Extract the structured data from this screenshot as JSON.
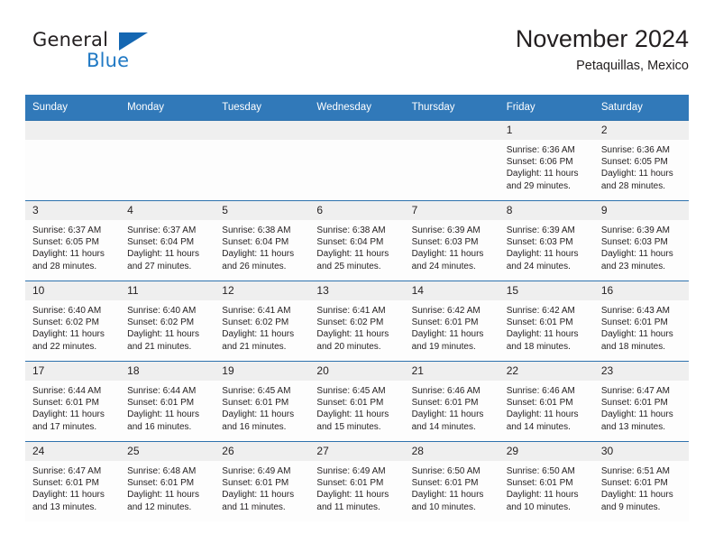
{
  "logo": {
    "word1": "General",
    "word2": "Blue",
    "triangle_color": "#1567b2",
    "blue_color": "#2079c4"
  },
  "header": {
    "title": "November 2024",
    "subtitle": "Petaquillas, Mexico"
  },
  "theme": {
    "header_blue": "#3179b9",
    "row_border_blue": "#2e72ad",
    "daynum_bg": "#efefef",
    "cell_bg": "#fdfdfd",
    "text": "#231f20"
  },
  "labels": {
    "sunrise_prefix": "Sunrise:",
    "sunset_prefix": "Sunset:",
    "daylight_prefix": "Daylight:"
  },
  "weekdays": [
    "Sunday",
    "Monday",
    "Tuesday",
    "Wednesday",
    "Thursday",
    "Friday",
    "Saturday"
  ],
  "weeks": [
    [
      {
        "day": ""
      },
      {
        "day": ""
      },
      {
        "day": ""
      },
      {
        "day": ""
      },
      {
        "day": ""
      },
      {
        "day": "1",
        "sunrise": "Sunrise: 6:36 AM",
        "sunset": "Sunset: 6:06 PM",
        "daylight": "Daylight: 11 hours and 29 minutes."
      },
      {
        "day": "2",
        "sunrise": "Sunrise: 6:36 AM",
        "sunset": "Sunset: 6:05 PM",
        "daylight": "Daylight: 11 hours and 28 minutes."
      }
    ],
    [
      {
        "day": "3",
        "sunrise": "Sunrise: 6:37 AM",
        "sunset": "Sunset: 6:05 PM",
        "daylight": "Daylight: 11 hours and 28 minutes."
      },
      {
        "day": "4",
        "sunrise": "Sunrise: 6:37 AM",
        "sunset": "Sunset: 6:04 PM",
        "daylight": "Daylight: 11 hours and 27 minutes."
      },
      {
        "day": "5",
        "sunrise": "Sunrise: 6:38 AM",
        "sunset": "Sunset: 6:04 PM",
        "daylight": "Daylight: 11 hours and 26 minutes."
      },
      {
        "day": "6",
        "sunrise": "Sunrise: 6:38 AM",
        "sunset": "Sunset: 6:04 PM",
        "daylight": "Daylight: 11 hours and 25 minutes."
      },
      {
        "day": "7",
        "sunrise": "Sunrise: 6:39 AM",
        "sunset": "Sunset: 6:03 PM",
        "daylight": "Daylight: 11 hours and 24 minutes."
      },
      {
        "day": "8",
        "sunrise": "Sunrise: 6:39 AM",
        "sunset": "Sunset: 6:03 PM",
        "daylight": "Daylight: 11 hours and 24 minutes."
      },
      {
        "day": "9",
        "sunrise": "Sunrise: 6:39 AM",
        "sunset": "Sunset: 6:03 PM",
        "daylight": "Daylight: 11 hours and 23 minutes."
      }
    ],
    [
      {
        "day": "10",
        "sunrise": "Sunrise: 6:40 AM",
        "sunset": "Sunset: 6:02 PM",
        "daylight": "Daylight: 11 hours and 22 minutes."
      },
      {
        "day": "11",
        "sunrise": "Sunrise: 6:40 AM",
        "sunset": "Sunset: 6:02 PM",
        "daylight": "Daylight: 11 hours and 21 minutes."
      },
      {
        "day": "12",
        "sunrise": "Sunrise: 6:41 AM",
        "sunset": "Sunset: 6:02 PM",
        "daylight": "Daylight: 11 hours and 21 minutes."
      },
      {
        "day": "13",
        "sunrise": "Sunrise: 6:41 AM",
        "sunset": "Sunset: 6:02 PM",
        "daylight": "Daylight: 11 hours and 20 minutes."
      },
      {
        "day": "14",
        "sunrise": "Sunrise: 6:42 AM",
        "sunset": "Sunset: 6:01 PM",
        "daylight": "Daylight: 11 hours and 19 minutes."
      },
      {
        "day": "15",
        "sunrise": "Sunrise: 6:42 AM",
        "sunset": "Sunset: 6:01 PM",
        "daylight": "Daylight: 11 hours and 18 minutes."
      },
      {
        "day": "16",
        "sunrise": "Sunrise: 6:43 AM",
        "sunset": "Sunset: 6:01 PM",
        "daylight": "Daylight: 11 hours and 18 minutes."
      }
    ],
    [
      {
        "day": "17",
        "sunrise": "Sunrise: 6:44 AM",
        "sunset": "Sunset: 6:01 PM",
        "daylight": "Daylight: 11 hours and 17 minutes."
      },
      {
        "day": "18",
        "sunrise": "Sunrise: 6:44 AM",
        "sunset": "Sunset: 6:01 PM",
        "daylight": "Daylight: 11 hours and 16 minutes."
      },
      {
        "day": "19",
        "sunrise": "Sunrise: 6:45 AM",
        "sunset": "Sunset: 6:01 PM",
        "daylight": "Daylight: 11 hours and 16 minutes."
      },
      {
        "day": "20",
        "sunrise": "Sunrise: 6:45 AM",
        "sunset": "Sunset: 6:01 PM",
        "daylight": "Daylight: 11 hours and 15 minutes."
      },
      {
        "day": "21",
        "sunrise": "Sunrise: 6:46 AM",
        "sunset": "Sunset: 6:01 PM",
        "daylight": "Daylight: 11 hours and 14 minutes."
      },
      {
        "day": "22",
        "sunrise": "Sunrise: 6:46 AM",
        "sunset": "Sunset: 6:01 PM",
        "daylight": "Daylight: 11 hours and 14 minutes."
      },
      {
        "day": "23",
        "sunrise": "Sunrise: 6:47 AM",
        "sunset": "Sunset: 6:01 PM",
        "daylight": "Daylight: 11 hours and 13 minutes."
      }
    ],
    [
      {
        "day": "24",
        "sunrise": "Sunrise: 6:47 AM",
        "sunset": "Sunset: 6:01 PM",
        "daylight": "Daylight: 11 hours and 13 minutes."
      },
      {
        "day": "25",
        "sunrise": "Sunrise: 6:48 AM",
        "sunset": "Sunset: 6:01 PM",
        "daylight": "Daylight: 11 hours and 12 minutes."
      },
      {
        "day": "26",
        "sunrise": "Sunrise: 6:49 AM",
        "sunset": "Sunset: 6:01 PM",
        "daylight": "Daylight: 11 hours and 11 minutes."
      },
      {
        "day": "27",
        "sunrise": "Sunrise: 6:49 AM",
        "sunset": "Sunset: 6:01 PM",
        "daylight": "Daylight: 11 hours and 11 minutes."
      },
      {
        "day": "28",
        "sunrise": "Sunrise: 6:50 AM",
        "sunset": "Sunset: 6:01 PM",
        "daylight": "Daylight: 11 hours and 10 minutes."
      },
      {
        "day": "29",
        "sunrise": "Sunrise: 6:50 AM",
        "sunset": "Sunset: 6:01 PM",
        "daylight": "Daylight: 11 hours and 10 minutes."
      },
      {
        "day": "30",
        "sunrise": "Sunrise: 6:51 AM",
        "sunset": "Sunset: 6:01 PM",
        "daylight": "Daylight: 11 hours and 9 minutes."
      }
    ]
  ]
}
